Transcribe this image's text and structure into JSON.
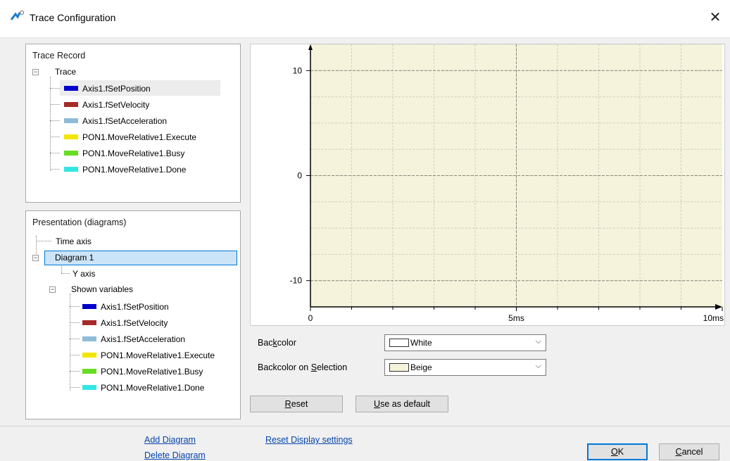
{
  "window": {
    "title": "Trace Configuration",
    "icon": "trace-app-icon",
    "close_icon": "close-icon"
  },
  "trace_record": {
    "title": "Trace Record",
    "root_label": "Trace",
    "items": [
      {
        "label": "Axis1.fSetPosition",
        "color": "#0000cc"
      },
      {
        "label": "Axis1.fSetVelocity",
        "color": "#a52a2a"
      },
      {
        "label": "Axis1.fSetAcceleration",
        "color": "#8fbcd8"
      },
      {
        "label": "PON1.MoveRelative1.Execute",
        "color": "#f2e600"
      },
      {
        "label": "PON1.MoveRelative1.Busy",
        "color": "#66dd22"
      },
      {
        "label": "PON1.MoveRelative1.Done",
        "color": "#33e6e6"
      }
    ]
  },
  "presentation": {
    "title": "Presentation (diagrams)",
    "time_axis": "Time axis",
    "diagram": "Diagram 1",
    "y_axis": "Y axis",
    "shown_variables": "Shown variables",
    "items": [
      {
        "label": "Axis1.fSetPosition",
        "color": "#0000cc"
      },
      {
        "label": "Axis1.fSetVelocity",
        "color": "#a52a2a"
      },
      {
        "label": "Axis1.fSetAcceleration",
        "color": "#8fbcd8"
      },
      {
        "label": "PON1.MoveRelative1.Execute",
        "color": "#f2e600"
      },
      {
        "label": "PON1.MoveRelative1.Busy",
        "color": "#66dd22"
      },
      {
        "label": "PON1.MoveRelative1.Done",
        "color": "#33e6e6"
      }
    ]
  },
  "chart_data": {
    "type": "line",
    "background": "#f5f3dc",
    "grid": true,
    "y_ticks": [
      {
        "label": "10",
        "value": 10
      },
      {
        "label": "0",
        "value": 0
      },
      {
        "label": "-10",
        "value": -10
      }
    ],
    "x_ticks": [
      {
        "label": "0",
        "value": 0
      },
      {
        "label": "5ms",
        "value": 5
      },
      {
        "label": "10ms",
        "value": 10
      }
    ],
    "xlim": [
      0,
      10
    ],
    "ylim": [
      -12.5,
      12.5
    ],
    "series": []
  },
  "settings": {
    "backcolor_label_pre": "Bac",
    "backcolor_label_key": "k",
    "backcolor_label_post": "color",
    "backcolor_value": "White",
    "backcolor_swatch": "#ffffff",
    "selection_label_pre": "Backcolor on ",
    "selection_label_key": "S",
    "selection_label_post": "election",
    "selection_value": "Beige",
    "selection_swatch": "#f5f3dc",
    "reset_key": "R",
    "reset_rest": "eset",
    "default_key": "U",
    "default_rest": "se as default"
  },
  "footer": {
    "add_diagram": "Add Diagram",
    "delete_diagram": "Delete Diagram",
    "reset_display": "Reset Display settings",
    "ok_key": "O",
    "ok_rest": "K",
    "cancel_key": "C",
    "cancel_rest": "ancel"
  }
}
